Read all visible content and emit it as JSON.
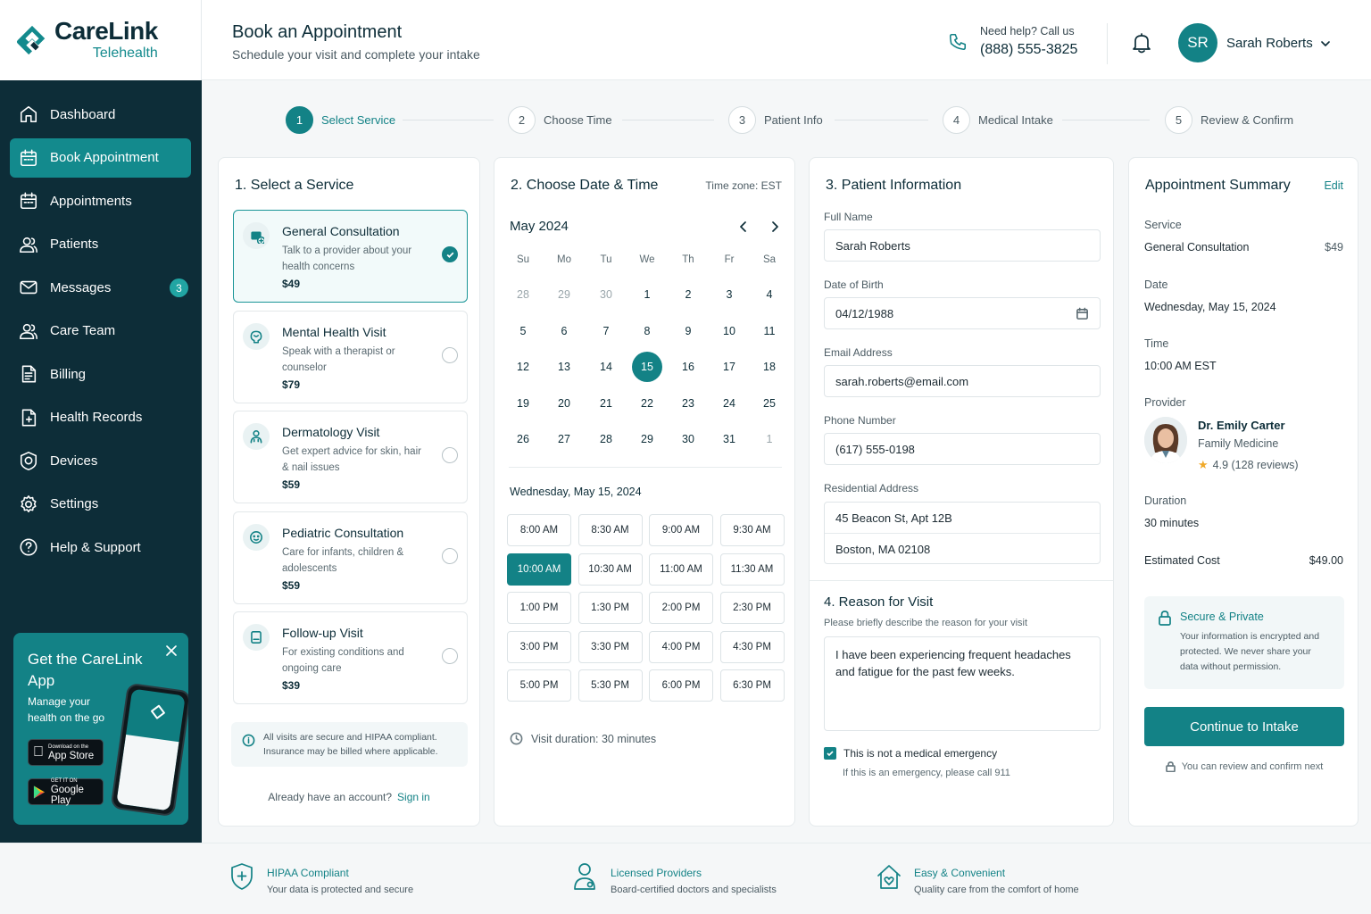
{
  "brand": {
    "name": "CareLink",
    "sub": "Telehealth"
  },
  "header": {
    "title": "Book an Appointment",
    "subtitle": "Schedule your visit and complete your intake",
    "help_label": "Need help? Call us",
    "help_phone": "(888) 555-3825",
    "user_initials": "SR",
    "user_name": "Sarah Roberts"
  },
  "nav": [
    {
      "label": "Dashboard",
      "icon": "home-icon"
    },
    {
      "label": "Book Appointment",
      "icon": "calendar-icon",
      "active": true
    },
    {
      "label": "Appointments",
      "icon": "calendar-icon"
    },
    {
      "label": "Patients",
      "icon": "users-icon"
    },
    {
      "label": "Messages",
      "icon": "mail-icon",
      "badge": "3"
    },
    {
      "label": "Care Team",
      "icon": "users-icon"
    },
    {
      "label": "Billing",
      "icon": "file-icon"
    },
    {
      "label": "Health Records",
      "icon": "record-icon"
    },
    {
      "label": "Devices",
      "icon": "device-icon"
    },
    {
      "label": "Settings",
      "icon": "gear-icon"
    },
    {
      "label": "Help & Support",
      "icon": "help-icon"
    }
  ],
  "promo": {
    "title": "Get the CareLink App",
    "desc": "Manage your health on the go",
    "appstore_small": "Download on the",
    "appstore": "App Store",
    "play_small": "GET IT ON",
    "play": "Google Play"
  },
  "steps": [
    {
      "num": "1",
      "label": "Select Service",
      "active": true
    },
    {
      "num": "2",
      "label": "Choose Time"
    },
    {
      "num": "3",
      "label": "Patient Info"
    },
    {
      "num": "4",
      "label": "Medical Intake"
    },
    {
      "num": "5",
      "label": "Review & Confirm"
    }
  ],
  "services": {
    "title": "1. Select a Service",
    "items": [
      {
        "name": "General Consultation",
        "desc": "Talk to a provider about your health concerns",
        "price": "$49",
        "selected": true
      },
      {
        "name": "Mental Health Visit",
        "desc": "Speak with a therapist or counselor",
        "price": "$79"
      },
      {
        "name": "Dermatology Visit",
        "desc": "Get expert advice for skin, hair & nail issues",
        "price": "$59"
      },
      {
        "name": "Pediatric Consultation",
        "desc": "Care for infants, children & adolescents",
        "price": "$59"
      },
      {
        "name": "Follow-up Visit",
        "desc": "For existing conditions and ongoing care",
        "price": "$39"
      }
    ],
    "note": "All visits are secure and HIPAA compliant. Insurance may be billed where applicable.",
    "signin_prompt": "Already have an account?",
    "signin_link": "Sign in"
  },
  "calendar": {
    "title": "2. Choose Date & Time",
    "timezone": "Time zone: EST",
    "month": "May 2024",
    "dow": [
      "Su",
      "Mo",
      "Tu",
      "We",
      "Th",
      "Fr",
      "Sa"
    ],
    "weeks": [
      [
        {
          "d": "28",
          "m": 1
        },
        {
          "d": "29",
          "m": 1
        },
        {
          "d": "30",
          "m": 1
        },
        {
          "d": "1"
        },
        {
          "d": "2"
        },
        {
          "d": "3"
        },
        {
          "d": "4"
        }
      ],
      [
        {
          "d": "5"
        },
        {
          "d": "6"
        },
        {
          "d": "7"
        },
        {
          "d": "8"
        },
        {
          "d": "9"
        },
        {
          "d": "10"
        },
        {
          "d": "11"
        }
      ],
      [
        {
          "d": "12"
        },
        {
          "d": "13"
        },
        {
          "d": "14"
        },
        {
          "d": "15",
          "s": 1
        },
        {
          "d": "16"
        },
        {
          "d": "17"
        },
        {
          "d": "18"
        }
      ],
      [
        {
          "d": "19"
        },
        {
          "d": "20"
        },
        {
          "d": "21"
        },
        {
          "d": "22"
        },
        {
          "d": "23"
        },
        {
          "d": "24"
        },
        {
          "d": "25"
        }
      ],
      [
        {
          "d": "26"
        },
        {
          "d": "27"
        },
        {
          "d": "28"
        },
        {
          "d": "29"
        },
        {
          "d": "30"
        },
        {
          "d": "31"
        },
        {
          "d": "1",
          "m": 1
        }
      ]
    ],
    "selected_date": "Wednesday, May 15, 2024",
    "slots": [
      "8:00 AM",
      "8:30 AM",
      "9:00 AM",
      "9:30 AM",
      "10:00 AM",
      "10:30 AM",
      "11:00 AM",
      "11:30 AM",
      "1:00 PM",
      "1:30 PM",
      "2:00 PM",
      "2:30 PM",
      "3:00 PM",
      "3:30 PM",
      "4:00 PM",
      "4:30 PM",
      "5:00 PM",
      "5:30 PM",
      "6:00 PM",
      "6:30 PM"
    ],
    "selected_slot": "10:00 AM",
    "duration": "Visit duration: 30 minutes"
  },
  "patient": {
    "title": "3. Patient Information",
    "full_name_label": "Full Name",
    "full_name": "Sarah Roberts",
    "dob_label": "Date of Birth",
    "dob": "04/12/1988",
    "email_label": "Email Address",
    "email": "sarah.roberts@email.com",
    "phone_label": "Phone Number",
    "phone": "(617) 555-0198",
    "address_label": "Residential Address",
    "address1": "45 Beacon St, Apt 12B",
    "address2": "Boston, MA 02108",
    "reason_title": "4. Reason for Visit",
    "reason_sub": "Please briefly describe the reason for your visit",
    "reason": "I have been experiencing frequent headaches and fatigue for the past few weeks.",
    "emergency_label": "This is not a medical emergency",
    "emergency_checked": true,
    "emergency_note": "If this is an emergency, please call 911"
  },
  "summary": {
    "title": "Appointment Summary",
    "edit": "Edit",
    "service_label": "Service",
    "service": "General Consultation",
    "service_price": "$49",
    "date_label": "Date",
    "date": "Wednesday, May 15, 2024",
    "time_label": "Time",
    "time": "10:00 AM EST",
    "provider_label": "Provider",
    "provider_name": "Dr. Emily Carter",
    "provider_spec": "Family Medicine",
    "provider_rating": "4.9 (128 reviews)",
    "duration_label": "Duration",
    "duration": "30 minutes",
    "cost_label": "Estimated Cost",
    "cost": "$49.00",
    "secure_title": "Secure & Private",
    "secure_desc": "Your information is encrypted and protected. We never share your data without permission.",
    "continue": "Continue to Intake",
    "review_note": "You can review and confirm next"
  },
  "footer": [
    {
      "title": "HIPAA Compliant",
      "desc": "Your data is protected and secure"
    },
    {
      "title": "Licensed Providers",
      "desc": "Board-certified doctors and specialists"
    },
    {
      "title": "Easy & Convenient",
      "desc": "Quality care from the comfort of home"
    }
  ],
  "colors": {
    "accent": "#138286",
    "sidebar": "#0d2d38"
  }
}
